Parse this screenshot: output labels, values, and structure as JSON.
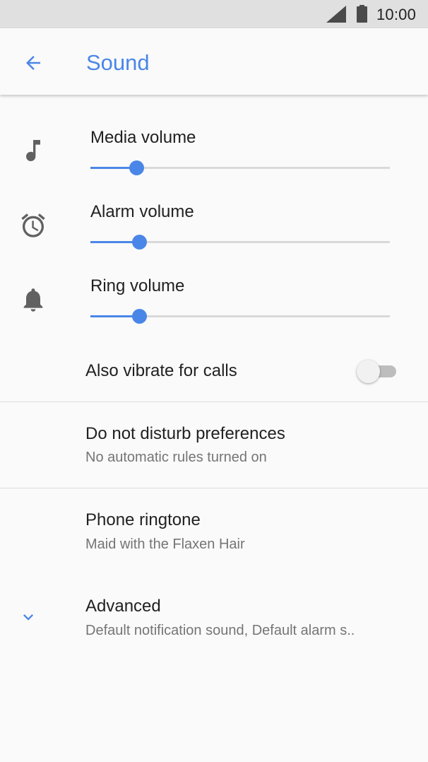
{
  "status_bar": {
    "time": "10:00",
    "icons": [
      "signal-icon",
      "battery-icon"
    ]
  },
  "app_bar": {
    "back_icon": "arrow-back-icon",
    "title": "Sound",
    "accent_color": "#4a86e8"
  },
  "volumes": [
    {
      "label": "Media volume",
      "icon": "music-note-icon",
      "level": 0.13
    },
    {
      "label": "Alarm volume",
      "icon": "alarm-clock-icon",
      "level": 0.14
    },
    {
      "label": "Ring volume",
      "icon": "bell-icon",
      "level": 0.14
    }
  ],
  "vibrate": {
    "label": "Also vibrate for calls",
    "enabled": false
  },
  "dnd": {
    "title": "Do not disturb preferences",
    "summary": "No automatic rules turned on"
  },
  "ringtone": {
    "title": "Phone ringtone",
    "summary": "Maid with the Flaxen Hair"
  },
  "advanced": {
    "icon": "chevron-down-icon",
    "title": "Advanced",
    "summary": "Default notification sound, Default alarm s.."
  }
}
